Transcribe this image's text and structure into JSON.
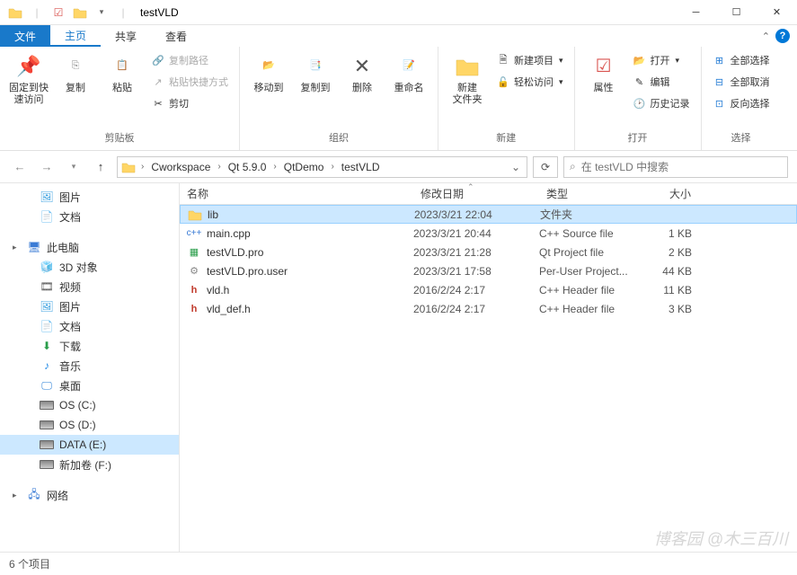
{
  "window": {
    "title": "testVLD"
  },
  "tabs": {
    "file": "文件",
    "home": "主页",
    "share": "共享",
    "view": "查看"
  },
  "ribbon": {
    "clipboard": {
      "pin": "固定到快\n速访问",
      "copy": "复制",
      "paste": "粘贴",
      "cut": "剪切",
      "copy_path": "复制路径",
      "paste_shortcut": "粘贴快捷方式",
      "label": "剪贴板"
    },
    "organize": {
      "move_to": "移动到",
      "copy_to": "复制到",
      "delete": "删除",
      "rename": "重命名",
      "label": "组织"
    },
    "new_group": {
      "new_folder": "新建\n文件夹",
      "new_item": "新建项目",
      "easy_access": "轻松访问",
      "label": "新建"
    },
    "open_group": {
      "properties": "属性",
      "open": "打开",
      "edit": "编辑",
      "history": "历史记录",
      "label": "打开"
    },
    "select_group": {
      "select_all": "全部选择",
      "select_none": "全部取消",
      "invert": "反向选择",
      "label": "选择"
    }
  },
  "breadcrumb": {
    "items": [
      "Cworkspace",
      "Qt 5.9.0",
      "QtDemo",
      "testVLD"
    ]
  },
  "search": {
    "placeholder": "在 testVLD 中搜索"
  },
  "nav_pane": {
    "quick": [
      {
        "name": "图片",
        "icon": "picture"
      },
      {
        "name": "文档",
        "icon": "document"
      }
    ],
    "this_pc": "此电脑",
    "pc_items": [
      {
        "name": "3D 对象",
        "icon": "3d"
      },
      {
        "name": "视频",
        "icon": "video"
      },
      {
        "name": "图片",
        "icon": "picture"
      },
      {
        "name": "文档",
        "icon": "document"
      },
      {
        "name": "下载",
        "icon": "download"
      },
      {
        "name": "音乐",
        "icon": "music"
      },
      {
        "name": "桌面",
        "icon": "desktop"
      },
      {
        "name": "OS (C:)",
        "icon": "disk"
      },
      {
        "name": "OS (D:)",
        "icon": "disk"
      },
      {
        "name": "DATA (E:)",
        "icon": "disk",
        "selected": true
      },
      {
        "name": "新加卷 (F:)",
        "icon": "disk"
      }
    ],
    "network": "网络"
  },
  "columns": {
    "name": "名称",
    "date": "修改日期",
    "type": "类型",
    "size": "大小"
  },
  "files": [
    {
      "name": "lib",
      "date": "2023/3/21 22:04",
      "type": "文件夹",
      "size": "",
      "icon": "folder",
      "selected": true
    },
    {
      "name": "main.cpp",
      "date": "2023/3/21 20:44",
      "type": "C++ Source file",
      "size": "1 KB",
      "icon": "cpp"
    },
    {
      "name": "testVLD.pro",
      "date": "2023/3/21 21:28",
      "type": "Qt Project file",
      "size": "2 KB",
      "icon": "pro"
    },
    {
      "name": "testVLD.pro.user",
      "date": "2023/3/21 17:58",
      "type": "Per-User Project...",
      "size": "44 KB",
      "icon": "user"
    },
    {
      "name": "vld.h",
      "date": "2016/2/24 2:17",
      "type": "C++ Header file",
      "size": "11 KB",
      "icon": "h"
    },
    {
      "name": "vld_def.h",
      "date": "2016/2/24 2:17",
      "type": "C++ Header file",
      "size": "3 KB",
      "icon": "h"
    }
  ],
  "status": {
    "text": "6 个项目"
  },
  "watermark": "博客园 @木三百川"
}
